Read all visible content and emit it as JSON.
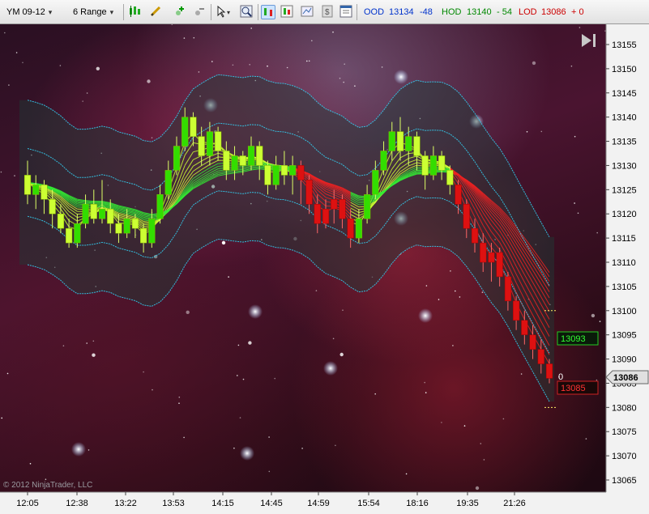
{
  "toolbar": {
    "instrument": "YM 09-12",
    "period": "6 Range",
    "icons": [
      "candlestick-icon",
      "pencil-icon",
      "add-indicator-icon",
      "remove-indicator-icon",
      "pointer-icon",
      "zoom-icon",
      "bar-type-icon",
      "chart-style-icon",
      "data-box-icon",
      "cash-icon",
      "properties-icon"
    ]
  },
  "stats": {
    "ood_label": "OOD",
    "ood_value": "13134",
    "ood_change": "-48",
    "hod_label": "HOD",
    "hod_value": "13140",
    "hod_change": "- 54",
    "lod_label": "LOD",
    "lod_value": "13086",
    "lod_change": "+ 0"
  },
  "colors": {
    "ood": "#0033cc",
    "hod": "#008800",
    "lod": "#cc0000",
    "bull": "#ccff33",
    "bull_body": "#33dd00",
    "bear": "#dd1111",
    "band": "#33ccee"
  },
  "chart_data": {
    "type": "candlestick",
    "y_axis": {
      "min": 13060,
      "max": 13157,
      "ticks": [
        13155,
        13150,
        13145,
        13140,
        13135,
        13130,
        13125,
        13120,
        13115,
        13110,
        13105,
        13100,
        13095,
        13090,
        13085,
        13080,
        13075,
        13070,
        13065
      ]
    },
    "x_axis": {
      "labels": [
        "12:05",
        "12:38",
        "13:22",
        "13:53",
        "14:15",
        "14:45",
        "14:59",
        "15:54",
        "18:16",
        "19:35",
        "21:26"
      ]
    },
    "price_markers": {
      "current": "13086",
      "upper": "13093",
      "lower": "13085",
      "zero": "0"
    },
    "copyright": "© 2012 NinjaTrader, LLC",
    "series": [
      {
        "o": 13128,
        "c": 13124,
        "h": 13131,
        "l": 13122
      },
      {
        "o": 13124,
        "c": 13126,
        "h": 13128,
        "l": 13121
      },
      {
        "o": 13126,
        "c": 13123,
        "h": 13127,
        "l": 13120
      },
      {
        "o": 13123,
        "c": 13120,
        "h": 13125,
        "l": 13117
      },
      {
        "o": 13120,
        "c": 13117,
        "h": 13122,
        "l": 13116
      },
      {
        "o": 13117,
        "c": 13114,
        "h": 13119,
        "l": 13113
      },
      {
        "o": 13114,
        "c": 13118,
        "h": 13120,
        "l": 13113
      },
      {
        "o": 13118,
        "c": 13122,
        "h": 13124,
        "l": 13117
      },
      {
        "o": 13122,
        "c": 13119,
        "h": 13125,
        "l": 13118
      },
      {
        "o": 13119,
        "c": 13121,
        "h": 13127,
        "l": 13118
      },
      {
        "o": 13121,
        "c": 13118,
        "h": 13123,
        "l": 13116
      },
      {
        "o": 13118,
        "c": 13116,
        "h": 13120,
        "l": 13114
      },
      {
        "o": 13116,
        "c": 13119,
        "h": 13121,
        "l": 13115
      },
      {
        "o": 13119,
        "c": 13117,
        "h": 13120,
        "l": 13115
      },
      {
        "o": 13117,
        "c": 13114,
        "h": 13118,
        "l": 13112
      },
      {
        "o": 13114,
        "c": 13119,
        "h": 13121,
        "l": 13113
      },
      {
        "o": 13119,
        "c": 13124,
        "h": 13126,
        "l": 13118
      },
      {
        "o": 13124,
        "c": 13129,
        "h": 13131,
        "l": 13123
      },
      {
        "o": 13129,
        "c": 13134,
        "h": 13136,
        "l": 13128
      },
      {
        "o": 13134,
        "c": 13140,
        "h": 13142,
        "l": 13133
      },
      {
        "o": 13140,
        "c": 13136,
        "h": 13141,
        "l": 13134
      },
      {
        "o": 13136,
        "c": 13132,
        "h": 13138,
        "l": 13130
      },
      {
        "o": 13132,
        "c": 13137,
        "h": 13139,
        "l": 13130
      },
      {
        "o": 13137,
        "c": 13133,
        "h": 13138,
        "l": 13131
      },
      {
        "o": 13133,
        "c": 13129,
        "h": 13135,
        "l": 13127
      },
      {
        "o": 13129,
        "c": 13132,
        "h": 13134,
        "l": 13127
      },
      {
        "o": 13132,
        "c": 13130,
        "h": 13133,
        "l": 13128
      },
      {
        "o": 13130,
        "c": 13134,
        "h": 13136,
        "l": 13129
      },
      {
        "o": 13134,
        "c": 13130,
        "h": 13135,
        "l": 13127
      },
      {
        "o": 13130,
        "c": 13126,
        "h": 13131,
        "l": 13124
      },
      {
        "o": 13126,
        "c": 13130,
        "h": 13132,
        "l": 13125
      },
      {
        "o": 13130,
        "c": 13128,
        "h": 13133,
        "l": 13126
      },
      {
        "o": 13128,
        "c": 13130,
        "h": 13132,
        "l": 13124
      },
      {
        "o": 13130,
        "c": 13127,
        "h": 13131,
        "l": 13122
      },
      {
        "o": 13127,
        "c": 13122,
        "h": 13128,
        "l": 13120
      },
      {
        "o": 13122,
        "c": 13118,
        "h": 13124,
        "l": 13116
      },
      {
        "o": 13118,
        "c": 13121,
        "h": 13123,
        "l": 13117
      },
      {
        "o": 13121,
        "c": 13123,
        "h": 13125,
        "l": 13118
      },
      {
        "o": 13123,
        "c": 13119,
        "h": 13124,
        "l": 13117
      },
      {
        "o": 13119,
        "c": 13115,
        "h": 13121,
        "l": 13113
      },
      {
        "o": 13115,
        "c": 13119,
        "h": 13121,
        "l": 13114
      },
      {
        "o": 13119,
        "c": 13124,
        "h": 13126,
        "l": 13118
      },
      {
        "o": 13124,
        "c": 13129,
        "h": 13131,
        "l": 13123
      },
      {
        "o": 13129,
        "c": 13133,
        "h": 13135,
        "l": 13128
      },
      {
        "o": 13133,
        "c": 13137,
        "h": 13139,
        "l": 13131
      },
      {
        "o": 13137,
        "c": 13133,
        "h": 13140,
        "l": 13131
      },
      {
        "o": 13133,
        "c": 13136,
        "h": 13138,
        "l": 13130
      },
      {
        "o": 13136,
        "c": 13132,
        "h": 13137,
        "l": 13129
      },
      {
        "o": 13132,
        "c": 13128,
        "h": 13133,
        "l": 13125
      },
      {
        "o": 13128,
        "c": 13132,
        "h": 13134,
        "l": 13127
      },
      {
        "o": 13132,
        "c": 13129,
        "h": 13133,
        "l": 13127
      },
      {
        "o": 13129,
        "c": 13126,
        "h": 13130,
        "l": 13124
      },
      {
        "o": 13126,
        "c": 13122,
        "h": 13127,
        "l": 13120
      },
      {
        "o": 13122,
        "c": 13117,
        "h": 13123,
        "l": 13115
      },
      {
        "o": 13117,
        "c": 13114,
        "h": 13119,
        "l": 13112
      },
      {
        "o": 13114,
        "c": 13110,
        "h": 13116,
        "l": 13108
      },
      {
        "o": 13110,
        "c": 13112,
        "h": 13114,
        "l": 13106
      },
      {
        "o": 13112,
        "c": 13107,
        "h": 13113,
        "l": 13105
      },
      {
        "o": 13107,
        "c": 13102,
        "h": 13108,
        "l": 13100
      },
      {
        "o": 13102,
        "c": 13098,
        "h": 13103,
        "l": 13096
      },
      {
        "o": 13098,
        "c": 13095,
        "h": 13100,
        "l": 13093
      },
      {
        "o": 13095,
        "c": 13092,
        "h": 13097,
        "l": 13090
      },
      {
        "o": 13092,
        "c": 13089,
        "h": 13094,
        "l": 13087
      },
      {
        "o": 13089,
        "c": 13086,
        "h": 13090,
        "l": 13085
      }
    ]
  }
}
